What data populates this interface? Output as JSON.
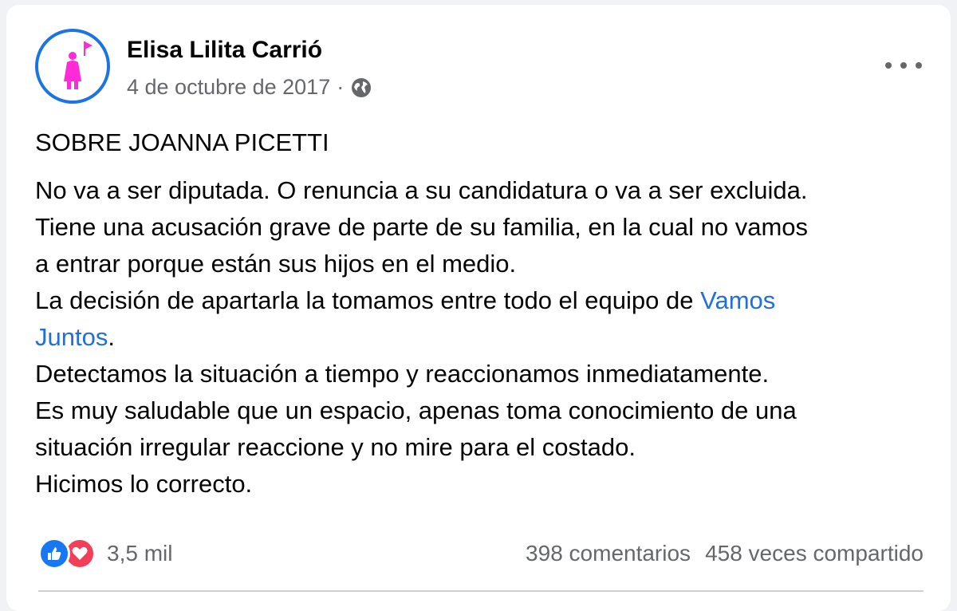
{
  "post": {
    "author": "Elisa Lilita Carrió",
    "date": "4 de octubre de 2017",
    "separator": "·",
    "privacy_icon": "globe-icon",
    "title": "SOBRE JOANNA PICETTI",
    "lines": [
      "No va a ser diputada. O renuncia a su candidatura o va a ser excluida.",
      "Tiene una acusación grave de parte de su familia, en la cual no vamos",
      "a entrar porque están sus hijos en el medio.",
      "La decisión de apartarla la tomamos entre todo el equipo de ",
      "Vamos",
      "Juntos",
      ".",
      "Detectamos la situación a tiempo y reaccionamos inmediatamente.",
      "Es muy saludable que un espacio, apenas toma conocimiento de una",
      "situación irregular reaccione y no mire para el costado.",
      "Hicimos lo correcto."
    ]
  },
  "footer": {
    "reactions_count": "3,5 mil",
    "comments": "398 comentarios",
    "shares": "458 veces compartido"
  },
  "colors": {
    "link": "#216fdb",
    "avatar_ring": "#1b74e4",
    "avatar_figure": "#ff2bd6",
    "like": "#1877f2",
    "love": "#f33e58"
  }
}
